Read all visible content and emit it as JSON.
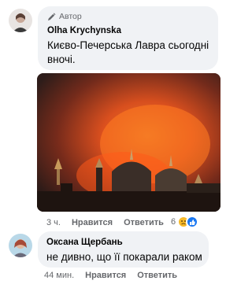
{
  "comment1": {
    "author_badge": "Автор",
    "author_name": "Olha Krychynska",
    "text_line1": "Києво-Печерська Лавра сьогодні",
    "text_line2": "вночі.",
    "time": "3 ч.",
    "like_label": "Нравится",
    "reply_label": "Ответить",
    "reaction_count": "6"
  },
  "comment2": {
    "author_name": "Оксана Щербань",
    "text": "не дивно, що її покарали раком",
    "time": "44 мин.",
    "like_label": "Нравится",
    "reply_label": "Ответить"
  }
}
